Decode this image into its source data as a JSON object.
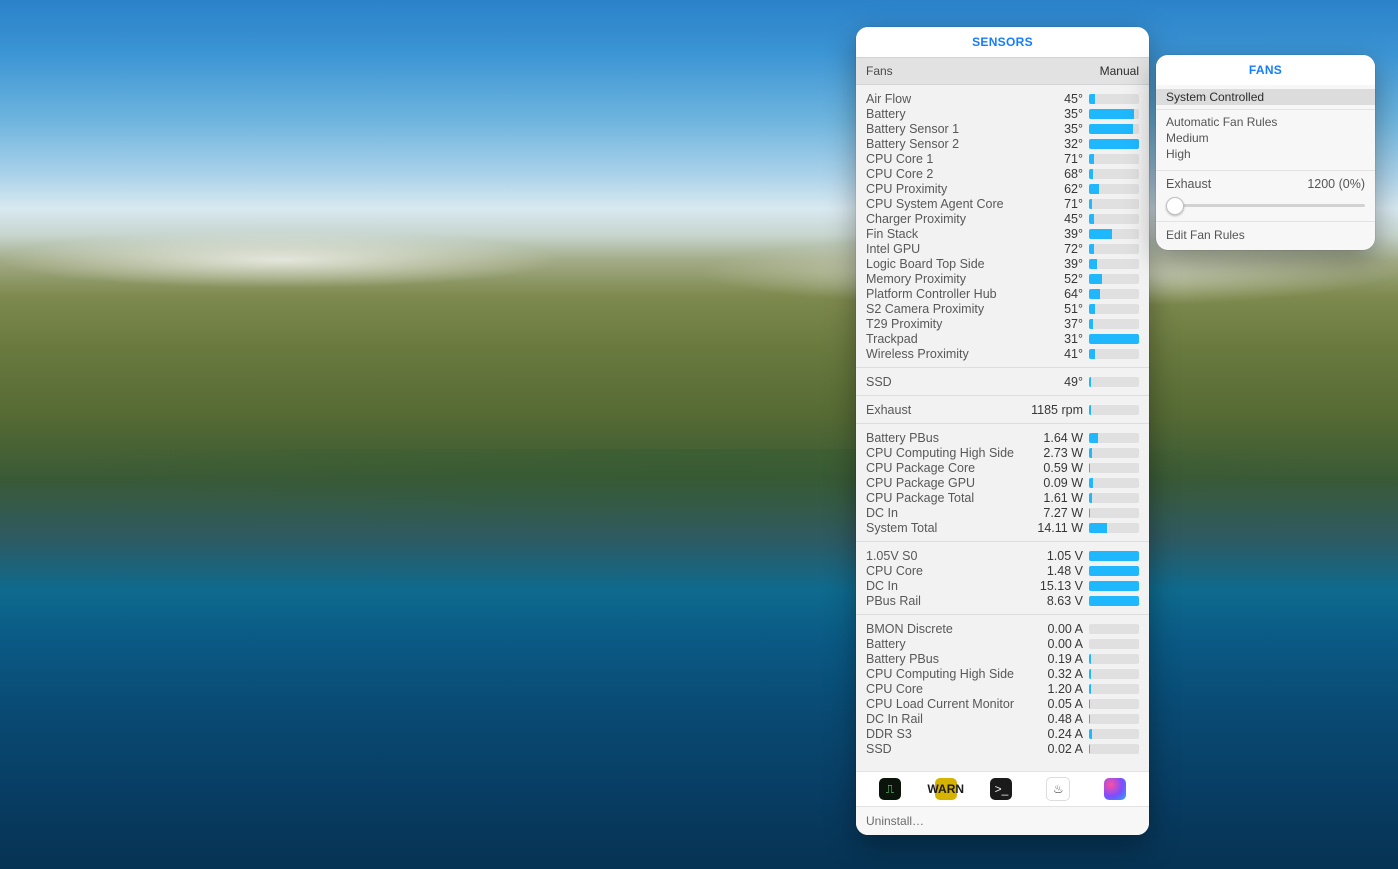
{
  "sensors_panel": {
    "title": "SENSORS",
    "mode_left": "Fans",
    "mode_right": "Manual",
    "groups": [
      {
        "kind": "temp",
        "rows": [
          {
            "name": "Air Flow",
            "value": "45°",
            "pct": 12
          },
          {
            "name": "Battery",
            "value": "35°",
            "pct": 90
          },
          {
            "name": "Battery Sensor 1",
            "value": "35°",
            "pct": 88
          },
          {
            "name": "Battery Sensor 2",
            "value": "32°",
            "pct": 100
          },
          {
            "name": "CPU Core 1",
            "value": "71°",
            "pct": 10
          },
          {
            "name": "CPU Core 2",
            "value": "68°",
            "pct": 7
          },
          {
            "name": "CPU Proximity",
            "value": "62°",
            "pct": 20
          },
          {
            "name": "CPU System Agent Core",
            "value": "71°",
            "pct": 5
          },
          {
            "name": "Charger Proximity",
            "value": "45°",
            "pct": 10
          },
          {
            "name": "Fin Stack",
            "value": "39°",
            "pct": 45
          },
          {
            "name": "Intel GPU",
            "value": "72°",
            "pct": 10
          },
          {
            "name": "Logic Board Top Side",
            "value": "39°",
            "pct": 15
          },
          {
            "name": "Memory Proximity",
            "value": "52°",
            "pct": 25
          },
          {
            "name": "Platform Controller Hub",
            "value": "64°",
            "pct": 22
          },
          {
            "name": "S2 Camera Proximity",
            "value": "51°",
            "pct": 12
          },
          {
            "name": "T29 Proximity",
            "value": "37°",
            "pct": 8
          },
          {
            "name": "Trackpad",
            "value": "31°",
            "pct": 100
          },
          {
            "name": "Wireless Proximity",
            "value": "41°",
            "pct": 12
          }
        ]
      },
      {
        "kind": "temp",
        "rows": [
          {
            "name": "SSD",
            "value": "49°",
            "pct": 3
          }
        ]
      },
      {
        "kind": "fan",
        "rows": [
          {
            "name": "Exhaust",
            "value": "1185 rpm",
            "pct": 4
          }
        ]
      },
      {
        "kind": "power",
        "rows": [
          {
            "name": "Battery PBus",
            "value": "1.64 W",
            "pct": 18
          },
          {
            "name": "CPU Computing High Side",
            "value": "2.73 W",
            "pct": 6
          },
          {
            "name": "CPU Package Core",
            "value": "0.59 W",
            "pct": 2
          },
          {
            "name": "CPU Package GPU",
            "value": "0.09 W",
            "pct": 8
          },
          {
            "name": "CPU Package Total",
            "value": "1.61 W",
            "pct": 5
          },
          {
            "name": "DC In",
            "value": "7.27 W",
            "pct": 2
          },
          {
            "name": "System Total",
            "value": "14.11 W",
            "pct": 35
          }
        ]
      },
      {
        "kind": "voltage",
        "rows": [
          {
            "name": "1.05V S0",
            "value": "1.05 V",
            "pct": 100
          },
          {
            "name": "CPU Core",
            "value": "1.48 V",
            "pct": 100
          },
          {
            "name": "DC In",
            "value": "15.13 V",
            "pct": 100
          },
          {
            "name": "PBus Rail",
            "value": "8.63 V",
            "pct": 100
          }
        ]
      },
      {
        "kind": "current",
        "rows": [
          {
            "name": "BMON Discrete",
            "value": "0.00 A",
            "pct": 0
          },
          {
            "name": "Battery",
            "value": "0.00 A",
            "pct": 0
          },
          {
            "name": "Battery PBus",
            "value": "0.19 A",
            "pct": 3
          },
          {
            "name": "CPU Computing High Side",
            "value": "0.32 A",
            "pct": 4
          },
          {
            "name": "CPU Core",
            "value": "1.20 A",
            "pct": 3
          },
          {
            "name": "CPU Load Current Monitor",
            "value": "0.05 A",
            "pct": 2
          },
          {
            "name": "DC In Rail",
            "value": "0.48 A",
            "pct": 2
          },
          {
            "name": "DDR S3",
            "value": "0.24 A",
            "pct": 6
          },
          {
            "name": "SSD",
            "value": "0.02 A",
            "pct": 2
          }
        ]
      }
    ],
    "launchers": [
      {
        "name": "activity-monitor-icon",
        "glyph": "⎍"
      },
      {
        "name": "console-icon",
        "glyph": "WARN"
      },
      {
        "name": "terminal-icon",
        "glyph": ">_"
      },
      {
        "name": "system-info-icon",
        "glyph": "♨"
      },
      {
        "name": "color-sync-icon",
        "glyph": ""
      }
    ],
    "uninstall": "Uninstall…"
  },
  "fans_panel": {
    "title": "FANS",
    "items": [
      {
        "label": "System Controlled",
        "selected": true
      },
      {
        "sep": true
      },
      {
        "label": "Automatic Fan Rules"
      },
      {
        "label": "Medium"
      },
      {
        "label": "High"
      }
    ],
    "exhaust_label": "Exhaust",
    "exhaust_value": "1200 (0%)",
    "slider_pct": 0,
    "edit_rules": "Edit Fan Rules"
  }
}
